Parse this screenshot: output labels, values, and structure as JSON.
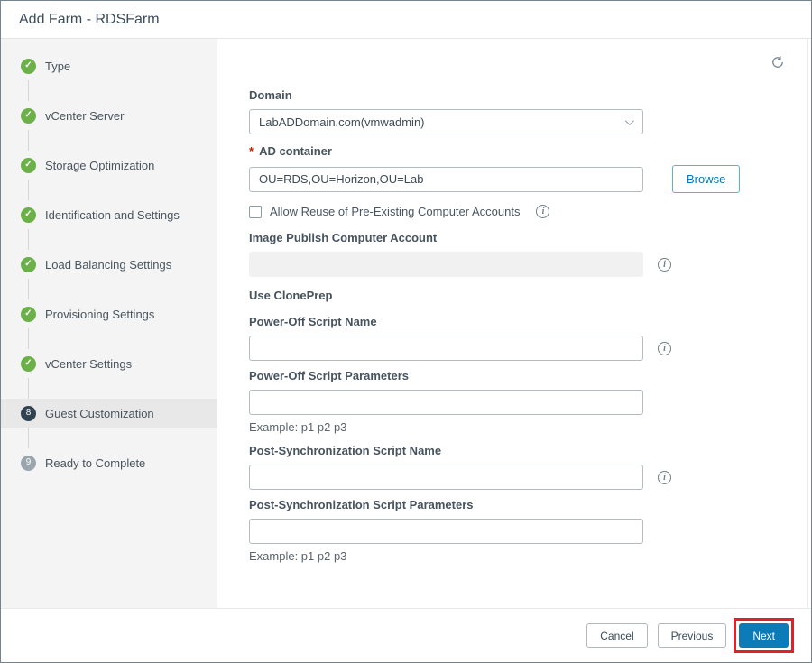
{
  "window": {
    "title": "Add Farm - RDSFarm"
  },
  "icons": {
    "check": "✓",
    "info": "i"
  },
  "sidebar": {
    "steps": [
      {
        "label": "Type",
        "status": "done"
      },
      {
        "label": "vCenter Server",
        "status": "done"
      },
      {
        "label": "Storage Optimization",
        "status": "done"
      },
      {
        "label": "Identification and Settings",
        "status": "done"
      },
      {
        "label": "Load Balancing Settings",
        "status": "done"
      },
      {
        "label": "Provisioning Settings",
        "status": "done"
      },
      {
        "label": "vCenter Settings",
        "status": "done"
      },
      {
        "label": "Guest Customization",
        "status": "active",
        "number": "8"
      },
      {
        "label": "Ready to Complete",
        "status": "pending",
        "number": "9"
      }
    ]
  },
  "form": {
    "domain": {
      "label": "Domain",
      "value": "LabADDomain.com(vmwadmin)"
    },
    "ad_container": {
      "required_marker": "*",
      "label": "AD container",
      "value": "OU=RDS,OU=Horizon,OU=Lab",
      "browse_label": "Browse"
    },
    "allow_reuse": {
      "label": "Allow Reuse of Pre-Existing Computer Accounts"
    },
    "image_publish": {
      "label": "Image Publish Computer Account",
      "value": ""
    },
    "use_cloneprep": {
      "label": "Use ClonePrep"
    },
    "power_off_name": {
      "label": "Power-Off Script Name",
      "value": ""
    },
    "power_off_params": {
      "label": "Power-Off Script Parameters",
      "value": "",
      "hint": "Example: p1 p2 p3"
    },
    "post_sync_name": {
      "label": "Post-Synchronization Script Name",
      "value": ""
    },
    "post_sync_params": {
      "label": "Post-Synchronization Script Parameters",
      "value": "",
      "hint": "Example: p1 p2 p3"
    }
  },
  "footer": {
    "cancel_label": "Cancel",
    "previous_label": "Previous",
    "next_label": "Next"
  }
}
